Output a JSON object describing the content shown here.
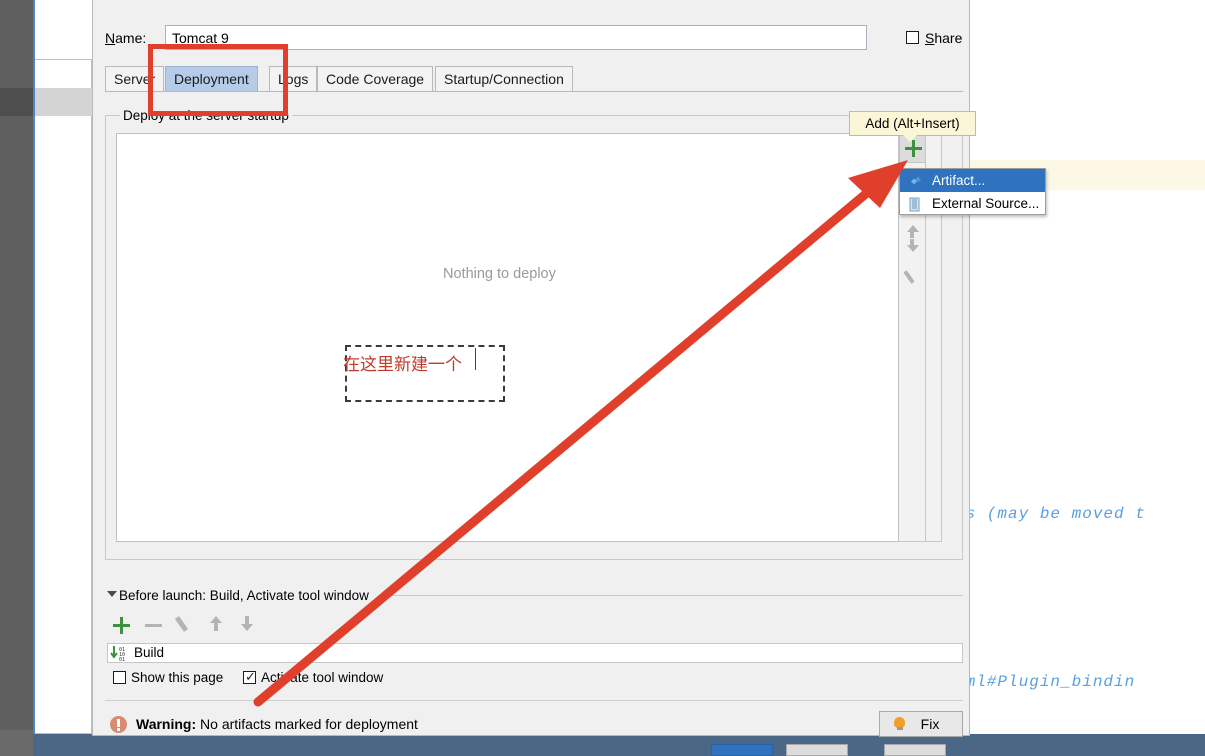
{
  "dialog": {
    "name_label": "Name:",
    "name_value": "Tomcat 9",
    "share_label": "Share",
    "tabs": [
      {
        "label": "Server",
        "selected": false
      },
      {
        "label": "Deployment",
        "selected": true
      },
      {
        "label": "Logs",
        "selected": false
      },
      {
        "label": "Code Coverage",
        "selected": false
      },
      {
        "label": "Startup/Connection",
        "selected": false
      }
    ],
    "deploy_group_title": "Deploy at the server startup",
    "empty_text": "Nothing to deploy"
  },
  "tooltip": {
    "text": "Add (Alt+Insert)"
  },
  "menu": {
    "items": [
      {
        "label": "Artifact...",
        "icon": "artifact-diamond-icon",
        "selected": true
      },
      {
        "label": "External Source...",
        "icon": "archive-icon",
        "selected": false
      }
    ]
  },
  "toolbar": {
    "add_icon": "plus-icon",
    "up_icon": "arrow-up-icon",
    "down_icon": "arrow-down-icon",
    "edit_icon": "pencil-icon"
  },
  "before_launch": {
    "title": "Before launch: Build, Activate tool window",
    "collapse_icon": "triangle-down-icon",
    "toolbar": [
      {
        "icon": "plus-icon",
        "name": "add"
      },
      {
        "icon": "minus-icon",
        "name": "remove"
      },
      {
        "icon": "pencil-icon",
        "name": "edit"
      },
      {
        "icon": "arrow-up-icon",
        "name": "move-up"
      },
      {
        "icon": "arrow-down-icon",
        "name": "move-down"
      }
    ],
    "task_label": "Build",
    "task_icon": "build-icon",
    "show_page_label": "Show this page",
    "show_page_checked": false,
    "activate_tool_label": "Activate tool window",
    "activate_tool_checked": true
  },
  "warning": {
    "icon": "warning-icon",
    "prefix": "Warning:",
    "message": "No artifacts marked for deployment",
    "fix_label": "Fix",
    "fix_icon": "lightbulb-icon"
  },
  "annotations": {
    "chinese_note": "在这里新建一个",
    "rect_color": "#e0402b",
    "arrow_color": "#e0402b"
  },
  "background_editor": {
    "line_1": "ts (may be moved t",
    "line_2": "tml#Plugin_bindin"
  }
}
